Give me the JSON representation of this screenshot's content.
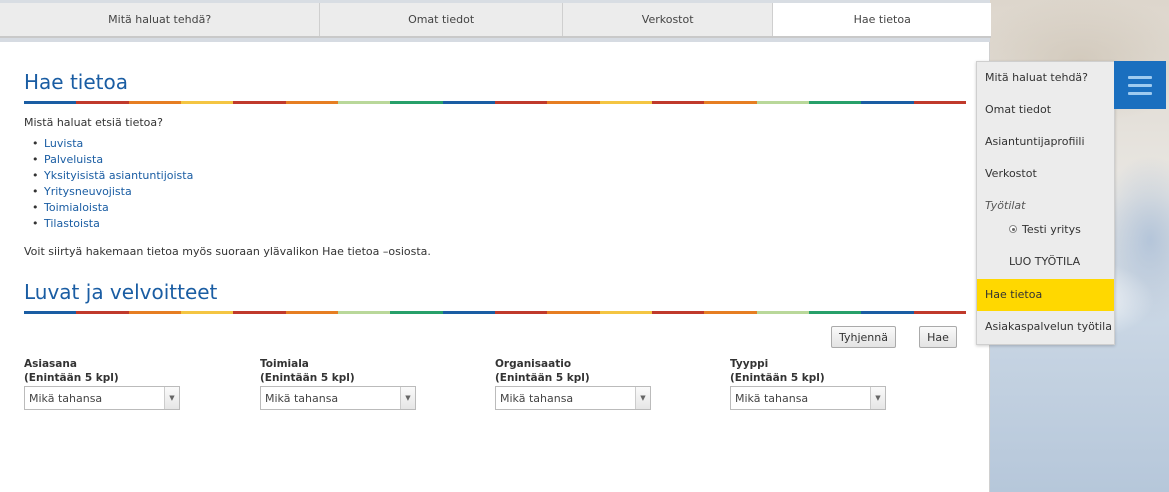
{
  "topnav": {
    "tabs": [
      {
        "label": "Mitä haluat tehdä?"
      },
      {
        "label": "Omat tiedot"
      },
      {
        "label": "Verkostot"
      },
      {
        "label": "Hae tietoa"
      }
    ],
    "active": "Hae tietoa"
  },
  "main": {
    "title": "Hae tietoa",
    "intro": "Mistä haluat etsiä tietoa?",
    "links": [
      {
        "label": "Luvista"
      },
      {
        "label": "Palveluista"
      },
      {
        "label": "Yksityisistä asiantuntijoista"
      },
      {
        "label": "Yritysneuvojista"
      },
      {
        "label": "Toimialoista"
      },
      {
        "label": "Tilastoista"
      }
    ],
    "note": "Voit siirtyä hakemaan tietoa myös suoraan ylävalikon Hae tietoa –osiosta.",
    "section_title": "Luvat ja velvoitteet",
    "buttons": {
      "clear": "Tyhjennä",
      "search": "Hae"
    },
    "filters": [
      {
        "label": "Asiasana",
        "limit": "(Enintään 5 kpl)",
        "value": "Mikä tahansa"
      },
      {
        "label": "Toimiala",
        "limit": "(Enintään 5 kpl)",
        "value": "Mikä tahansa"
      },
      {
        "label": "Organisaatio",
        "limit": "(Enintään 5 kpl)",
        "value": "Mikä tahansa"
      },
      {
        "label": "Tyyppi",
        "limit": "(Enintään 5 kpl)",
        "value": "Mikä tahansa"
      }
    ]
  },
  "sidemenu": {
    "items": [
      {
        "label": "Mitä haluat tehdä?"
      },
      {
        "label": "Omat tiedot"
      },
      {
        "label": "Asiantuntijaprofiili"
      },
      {
        "label": "Verkostot"
      },
      {
        "label": "Työtilat"
      },
      {
        "label": "Testi yritys"
      },
      {
        "label": "LUO TYÖTILA"
      },
      {
        "label": "Hae tietoa"
      },
      {
        "label": "Asiakaspalvelun työtila"
      }
    ]
  },
  "colors": {
    "accent": "#1a5da3",
    "active_menu": "#ffd800",
    "hamburger_bg": "#1a6fbf",
    "stripe": [
      "#1a5da3",
      "#c0392b",
      "#e67e22",
      "#f4c542",
      "#c0392b",
      "#e67e22",
      "#b9d89a",
      "#27a06a",
      "#1a5da3",
      "#c0392b",
      "#e67e22",
      "#f4c542",
      "#c0392b",
      "#e67e22",
      "#b9d89a",
      "#27a06a",
      "#1a5da3",
      "#c0392b"
    ]
  },
  "icons": {
    "menu": "hamburger-icon",
    "select_arrow": "chevron-down-icon",
    "radio": "radio-dot-icon"
  }
}
